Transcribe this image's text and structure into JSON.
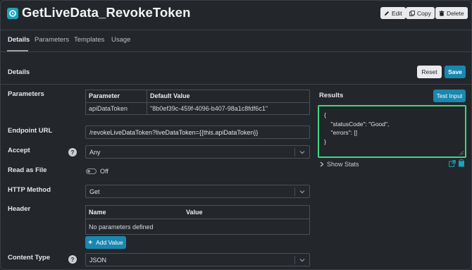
{
  "header": {
    "title": "GetLiveData_RevokeToken",
    "edit_label": "Edit",
    "copy_label": "Copy",
    "delete_label": "Delete"
  },
  "tabs": [
    {
      "label": "Details",
      "active": true
    },
    {
      "label": "Parameters"
    },
    {
      "label": "Templates"
    },
    {
      "label": "Usage"
    }
  ],
  "details": {
    "section_title": "Details",
    "reset_label": "Reset",
    "save_label": "Save"
  },
  "form": {
    "parameters_label": "Parameters",
    "parameters_table": {
      "headers": [
        "Parameter",
        "Default Value"
      ],
      "rows": [
        [
          "apiDataToken",
          "\"8b0ef39c-459f-4096-b407-98a1c8fdf6c1\""
        ]
      ]
    },
    "endpoint_label": "Endpoint URL",
    "endpoint_value": "/revokeLiveDataToken?liveDataToken={{this.apiDataToken}}",
    "accept_label": "Accept",
    "accept_value": "Any",
    "read_as_file_label": "Read as File",
    "read_as_file_value": "Off",
    "http_method_label": "HTTP Method",
    "http_method_value": "Get",
    "header_label": "Header",
    "header_table": {
      "headers": [
        "Name",
        "Value"
      ],
      "empty_text": "No parameters defined"
    },
    "add_value_label": "Add Value",
    "content_type_label": "Content Type",
    "content_type_value": "JSON"
  },
  "results": {
    "label": "Results",
    "test_input_label": "Test Input",
    "body_lines": [
      "{",
      "    \"statusCode\": \"Good\",",
      "    \"errors\": []",
      "}"
    ],
    "show_stats_label": "Show Stats"
  },
  "colors": {
    "background": "#23272c",
    "accent": "#1a87b0",
    "app_icon": "#1aa3bd",
    "highlight": "#3fd67e"
  }
}
